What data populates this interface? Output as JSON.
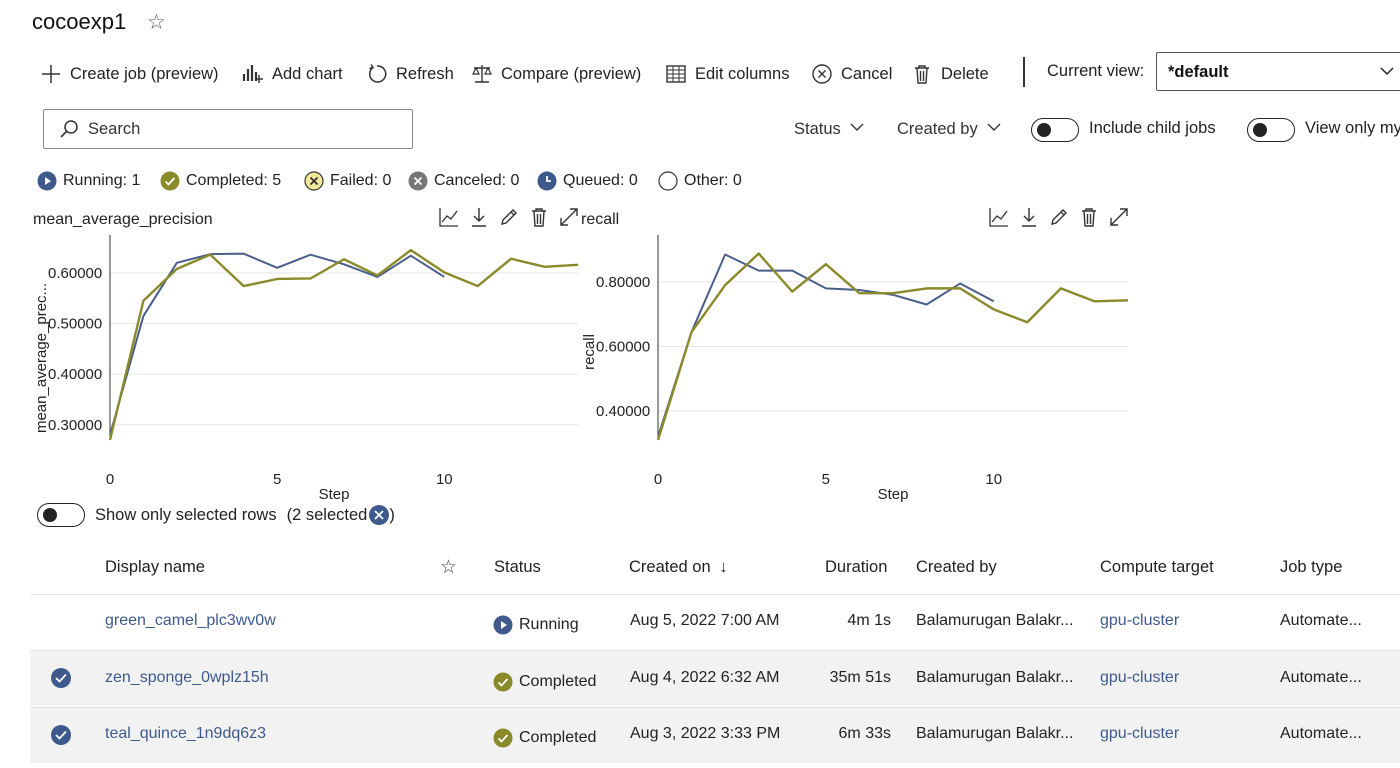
{
  "experiment": {
    "title": "cocoexp1"
  },
  "toolbar": {
    "create_job": "Create job (preview)",
    "add_chart": "Add chart",
    "refresh": "Refresh",
    "compare": "Compare (preview)",
    "edit_columns": "Edit columns",
    "cancel": "Cancel",
    "delete": "Delete",
    "current_view_label": "Current view:",
    "current_view_value": "*default"
  },
  "filters": {
    "search_placeholder": "Search",
    "status": "Status",
    "created_by": "Created by",
    "include_child_jobs": "Include child jobs",
    "view_only_mine": "View only my"
  },
  "status_summary": {
    "running": "Running: 1",
    "completed": "Completed: 5",
    "failed": "Failed: 0",
    "canceled": "Canceled: 0",
    "queued": "Queued: 0",
    "other": "Other: 0"
  },
  "colors": {
    "series_blue": "#4a5e8c",
    "series_olive": "#8a8a2a",
    "accent": "#3e5a8c"
  },
  "chart_data": [
    {
      "type": "line",
      "title": "mean_average_precision",
      "xlabel": "Step",
      "ylabel": "mean_average_prec...",
      "xlim": [
        0,
        14
      ],
      "ylim": [
        0.27,
        0.665
      ],
      "xticks": [
        "0",
        "5",
        "10"
      ],
      "yticks": [
        "0.30000",
        "0.40000",
        "0.50000",
        "0.60000"
      ],
      "grid": true,
      "series": [
        {
          "x": [
            0,
            1,
            2,
            3,
            4,
            5,
            6,
            7,
            8,
            9,
            10
          ],
          "values": [
            0.28,
            0.515,
            0.62,
            0.637,
            0.638,
            0.61,
            0.636,
            0.617,
            0.592,
            0.634,
            0.592
          ],
          "color": "#4a5e8c"
        },
        {
          "x": [
            0,
            1,
            2,
            3,
            4,
            5,
            6,
            7,
            8,
            9,
            10,
            11,
            12,
            13,
            14
          ],
          "values": [
            0.27,
            0.545,
            0.608,
            0.636,
            0.574,
            0.588,
            0.589,
            0.627,
            0.595,
            0.645,
            0.601,
            0.574,
            0.628,
            0.612,
            0.616
          ],
          "color": "#8a8a2a"
        }
      ]
    },
    {
      "type": "line",
      "title": "recall",
      "xlabel": "Step",
      "ylabel": "recall",
      "xlim": [
        0,
        14
      ],
      "ylim": [
        0.31,
        0.93
      ],
      "xticks": [
        "0",
        "5",
        "10"
      ],
      "yticks": [
        "0.40000",
        "0.60000",
        "0.80000"
      ],
      "grid": true,
      "series": [
        {
          "x": [
            0,
            1,
            2,
            3,
            4,
            5,
            6,
            7,
            8,
            9,
            10
          ],
          "values": [
            0.32,
            0.645,
            0.885,
            0.835,
            0.835,
            0.78,
            0.775,
            0.76,
            0.73,
            0.795,
            0.74
          ],
          "color": "#4a5e8c"
        },
        {
          "x": [
            0,
            1,
            2,
            3,
            4,
            5,
            6,
            7,
            8,
            9,
            10,
            11,
            12,
            13,
            14
          ],
          "values": [
            0.31,
            0.645,
            0.79,
            0.888,
            0.77,
            0.855,
            0.765,
            0.765,
            0.78,
            0.78,
            0.715,
            0.675,
            0.78,
            0.74,
            0.743
          ],
          "color": "#8a8a2a"
        }
      ]
    }
  ],
  "selection": {
    "label": "Show only selected rows",
    "count": "(2 selected",
    "close": ")"
  },
  "table": {
    "headers": {
      "display_name": "Display name",
      "status": "Status",
      "created_on": "Created on",
      "duration": "Duration",
      "created_by": "Created by",
      "compute_target": "Compute target",
      "job_type": "Job type"
    },
    "rows": [
      {
        "name": "green_camel_plc3wv0w",
        "status": "Running",
        "created_on": "Aug 5, 2022 7:00 AM",
        "duration": "4m 1s",
        "created_by": "Balamurugan Balakr...",
        "compute": "gpu-cluster",
        "job_type": "Automate..."
      },
      {
        "name": "zen_sponge_0wplz15h",
        "status": "Completed",
        "created_on": "Aug 4, 2022 6:32 AM",
        "duration": "35m 51s",
        "created_by": "Balamurugan Balakr...",
        "compute": "gpu-cluster",
        "job_type": "Automate..."
      },
      {
        "name": "teal_quince_1n9dq6z3",
        "status": "Completed",
        "created_on": "Aug 3, 2022 3:33 PM",
        "duration": "6m 33s",
        "created_by": "Balamurugan Balakr...",
        "compute": "gpu-cluster",
        "job_type": "Automate..."
      }
    ]
  }
}
